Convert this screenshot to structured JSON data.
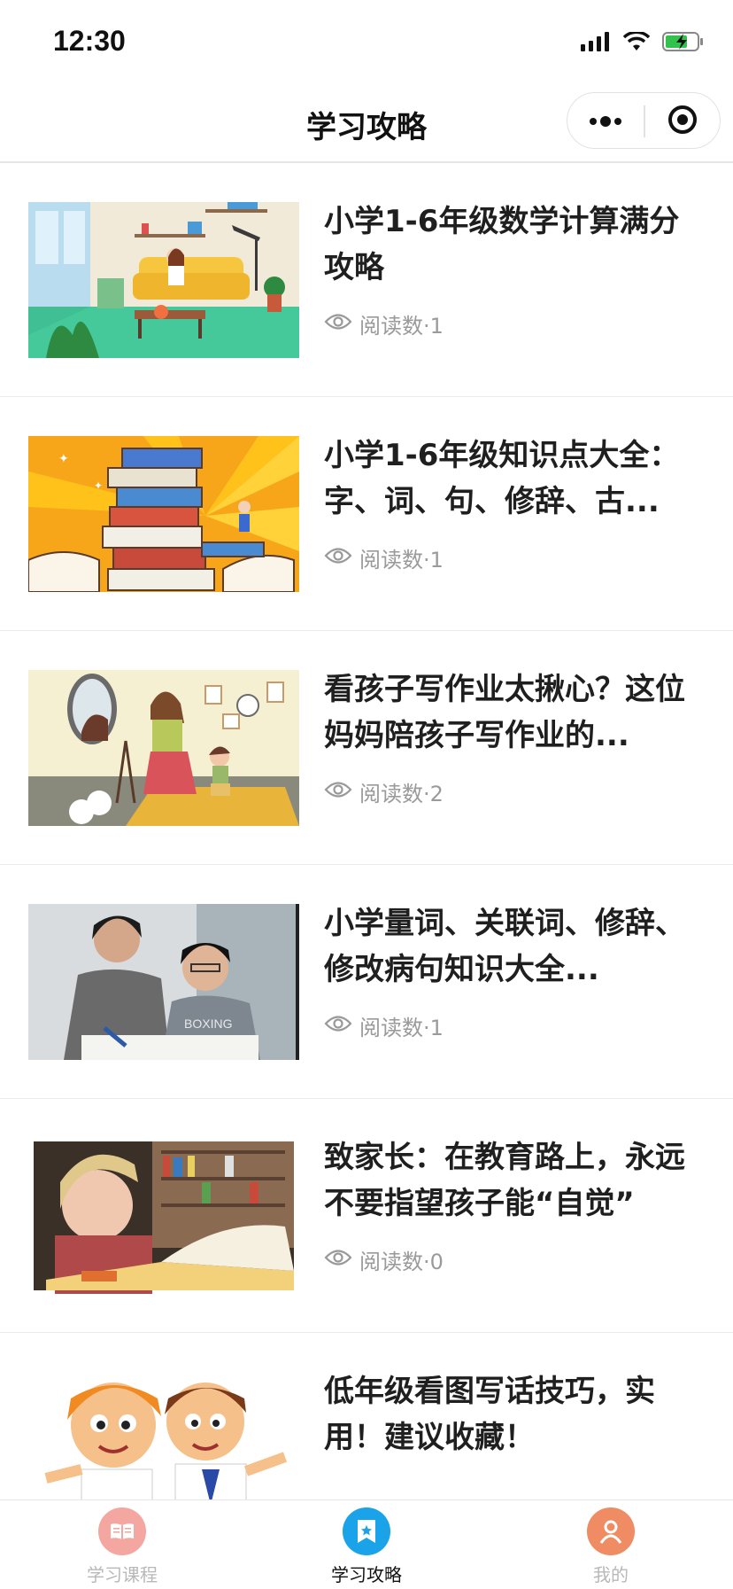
{
  "status": {
    "time": "12:30"
  },
  "nav": {
    "title": "学习攻略"
  },
  "articles": [
    {
      "title": "小学1-6年级数学计算满分攻略",
      "views_label": "阅读数·1",
      "thumb": "living-room-reading-illustration"
    },
    {
      "title": "小学1-6年级知识点大全：字、词、句、修辞、古...",
      "views_label": "阅读数·1",
      "thumb": "book-stack-illustration"
    },
    {
      "title": "看孩子写作业太揪心？这位妈妈陪孩子写作业的...",
      "views_label": "阅读数·2",
      "thumb": "mother-child-illustration"
    },
    {
      "title": "小学量词、关联词、修辞、修改病句知识大全...",
      "views_label": "阅读数·1",
      "thumb": "parent-child-study-photo"
    },
    {
      "title": "致家长：在教育路上，永远不要指望孩子能“自觉”",
      "views_label": "阅读数·0",
      "thumb": "child-reading-photo"
    },
    {
      "title": "低年级看图写话技巧，实用！建议收藏！",
      "views_label": "",
      "thumb": "cartoon-kids-illustration"
    }
  ],
  "tabs": [
    {
      "label": "学习课程",
      "icon": "book-icon",
      "color": "#f4a7a0",
      "active": false
    },
    {
      "label": "学习攻略",
      "icon": "bookmark-star-icon",
      "color": "#1aa3e8",
      "active": true
    },
    {
      "label": "我的",
      "icon": "person-icon",
      "color": "#ef8c63",
      "active": false
    }
  ],
  "colors": {
    "accent": "#1aa3e8",
    "text": "#1f1f1f",
    "muted": "#9a9a9a"
  }
}
